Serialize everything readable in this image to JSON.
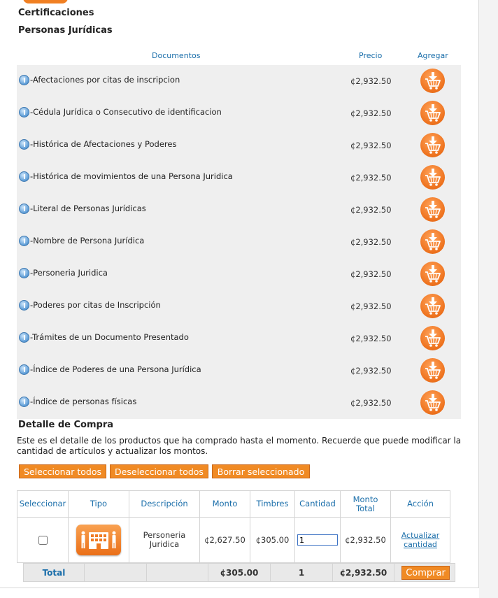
{
  "section": {
    "title": "Certificaciones",
    "subtitle": "Personas Jurídicas"
  },
  "documents": {
    "headers": {
      "documentos": "Documentos",
      "precio": "Precio",
      "agregar": "Agregar"
    },
    "rows": [
      {
        "name": "-Afectaciones por citas de inscripcion",
        "price": "¢2,932.50"
      },
      {
        "name": "-Cédula Jurídica o Consecutivo de identificacion",
        "price": "¢2,932.50"
      },
      {
        "name": "-Histórica de Afectaciones y Poderes",
        "price": "¢2,932.50"
      },
      {
        "name": "-Histórica de movimientos de una Persona Juridica",
        "price": "¢2,932.50"
      },
      {
        "name": "-Literal de Personas Jurídicas",
        "price": "¢2,932.50"
      },
      {
        "name": "-Nombre de Persona Jurídica",
        "price": "¢2,932.50"
      },
      {
        "name": "-Personeria Juridica",
        "price": "¢2,932.50"
      },
      {
        "name": "-Poderes por citas de Inscripción",
        "price": "¢2,932.50"
      },
      {
        "name": "-Trámites de un Documento Presentado",
        "price": "¢2,932.50"
      },
      {
        "name": "-Índice de Poderes de una Persona Jurídica",
        "price": "¢2,932.50"
      },
      {
        "name": "-Índice de personas físicas",
        "price": "¢2,932.50"
      }
    ]
  },
  "detail": {
    "title": "Detalle de Compra",
    "description": "Este es el detalle de los productos que ha comprado hasta el momento. Recuerde que puede modificar la cantidad de artículos y actualizar los montos.",
    "buttons": {
      "select_all": "Seleccionar todos",
      "deselect_all": "Deseleccionar todos",
      "delete_selected": "Borrar seleccionado"
    },
    "columns": {
      "seleccionar": "Seleccionar",
      "tipo": "Tipo",
      "descripcion": "Descripción",
      "monto": "Monto",
      "timbres": "Timbres",
      "cantidad": "Cantidad",
      "monto_total": "Monto Total",
      "accion": "Acción"
    },
    "item": {
      "checked": false,
      "tipo_icon": "building-people-icon",
      "descripcion": "Personeria Juridica",
      "monto": "¢2,627.50",
      "timbres": "¢305.00",
      "cantidad": "1",
      "monto_total": "¢2,932.50",
      "accion": "Actualizar cantidad"
    },
    "totals": {
      "label": "Total",
      "timbres": "¢305.00",
      "cantidad": "1",
      "monto_total": "¢2,932.50",
      "comprar": "Comprar"
    }
  },
  "colors": {
    "accent_orange": "#f08a24",
    "link_blue": "#1a6eaa",
    "table_bg": "#efefef"
  },
  "icons": {
    "info": "info-icon",
    "add_to_cart": "cart-download-icon"
  }
}
